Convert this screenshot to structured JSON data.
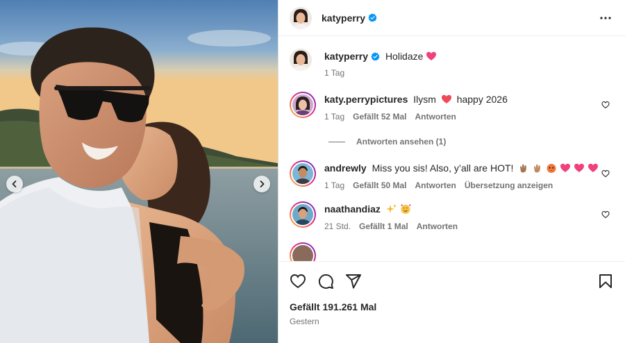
{
  "post": {
    "author": "katyperry",
    "caption_text": "Holidaze",
    "caption_time": "1 Tag",
    "likes": "Gefällt 191.261 Mal",
    "date": "Gestern"
  },
  "comments": [
    {
      "username": "katy.perrypictures",
      "text_before": "Ilysm",
      "text_after": "happy 2026",
      "time": "1 Tag",
      "likes": "Gefällt 52 Mal",
      "reply_label": "Antworten",
      "view_replies": "Antworten ansehen (1)"
    },
    {
      "username": "andrewly",
      "text": "Miss you sis! Also, y’all are HOT!",
      "time": "1 Tag",
      "likes": "Gefällt 50 Mal",
      "reply_label": "Antworten",
      "translate_label": "Übersetzung anzeigen"
    },
    {
      "username": "naathandiaz",
      "time": "21 Std.",
      "likes": "Gefällt 1 Mal",
      "reply_label": "Antworten"
    }
  ],
  "icons": {
    "more": "more-horizontal-icon",
    "like": "heart-icon",
    "comment": "comment-icon",
    "share": "share-icon",
    "save": "bookmark-icon",
    "verified": "verified-badge-icon"
  },
  "colors": {
    "verified": "#0095f6",
    "emoji_heart": "#ed4956",
    "text_secondary": "#737373"
  }
}
